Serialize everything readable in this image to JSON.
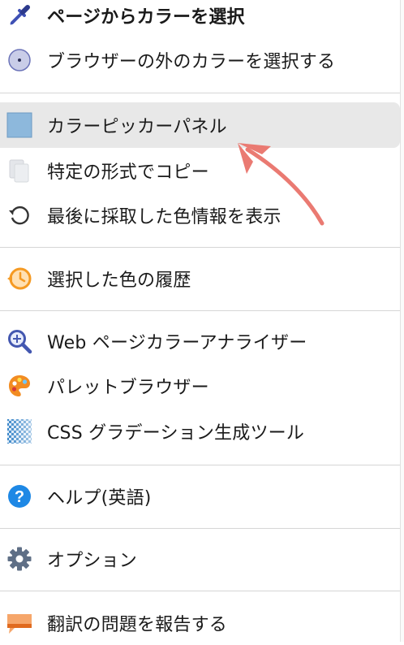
{
  "menu": {
    "items": [
      {
        "label": "ページからカラーを選択",
        "icon": "eyedropper-icon"
      },
      {
        "label": "ブラウザーの外のカラーを選択する",
        "icon": "color-disc-icon"
      },
      {
        "label": "カラーピッカーパネル",
        "icon": "color-swatch-icon"
      },
      {
        "label": "特定の形式でコピー",
        "icon": "copy-icon"
      },
      {
        "label": "最後に採取した色情報を表示",
        "icon": "history-arrow-icon"
      },
      {
        "label": "選択した色の履歴",
        "icon": "clock-icon"
      },
      {
        "label": "Web ページカラーアナライザー",
        "icon": "magnifier-icon"
      },
      {
        "label": "パレットブラウザー",
        "icon": "palette-icon"
      },
      {
        "label": "CSS グラデーション生成ツール",
        "icon": "gradient-icon"
      },
      {
        "label": "ヘルプ(英語)",
        "icon": "help-icon"
      },
      {
        "label": "オプション",
        "icon": "gear-icon"
      },
      {
        "label": "翻訳の問題を報告する",
        "icon": "speech-bubble-icon"
      }
    ]
  },
  "colors": {
    "highlight": "#e8e8e8",
    "separator": "#d6d6d6",
    "arrow": "#e8756a",
    "swatch": "#8db8dc",
    "help": "#1e88e5",
    "gear": "#546e8a",
    "clock": "#f59a23",
    "bubble": "#f08c3c"
  }
}
